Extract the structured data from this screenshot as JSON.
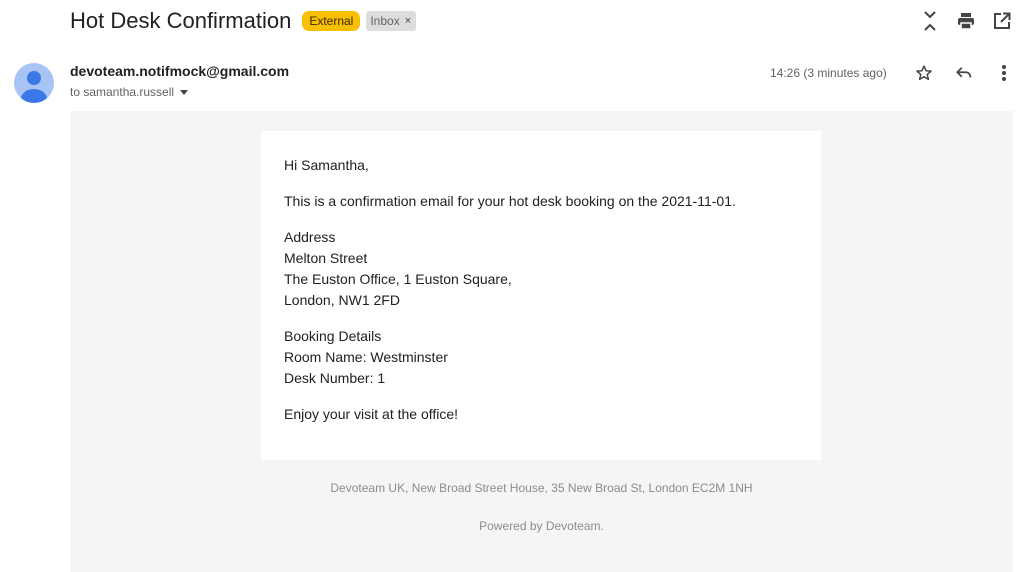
{
  "email": {
    "subject": "Hot Desk Confirmation",
    "labels": {
      "external": "External",
      "inbox": "Inbox",
      "remove_symbol": "×"
    },
    "sender": "devoteam.notifmock@gmail.com",
    "recipient": "to samantha.russell",
    "timestamp": "14:26 (3 minutes ago)"
  },
  "icons": {
    "top_actions": [
      "collapse-all-icon",
      "print-icon",
      "open-in-new-window-icon"
    ],
    "header_actions": [
      "star-icon",
      "reply-icon",
      "more-vert-icon"
    ]
  },
  "body": {
    "greeting": "Hi Samantha,",
    "intro": "This is a confirmation email for your hot desk booking on the 2021-11-01.",
    "address": {
      "heading": "Address",
      "line1": "Melton Street",
      "line2": "The Euston Office, 1 Euston Square,",
      "line3": "London, NW1 2FD"
    },
    "booking": {
      "heading": "Booking Details",
      "room": "Room Name: Westminster",
      "desk": "Desk Number: 1"
    },
    "closing": "Enjoy your visit at the office!"
  },
  "footer": {
    "address": "Devoteam UK, New Broad Street House, 35 New Broad St, London EC2M 1NH",
    "powered": "Powered by Devoteam."
  },
  "colors": {
    "external_label": "#f9bf03",
    "inbox_label": "#dddddd",
    "avatar": "#a7c4f5",
    "avatar_figure": "#3b78e7",
    "body_background": "#f5f5f5"
  }
}
